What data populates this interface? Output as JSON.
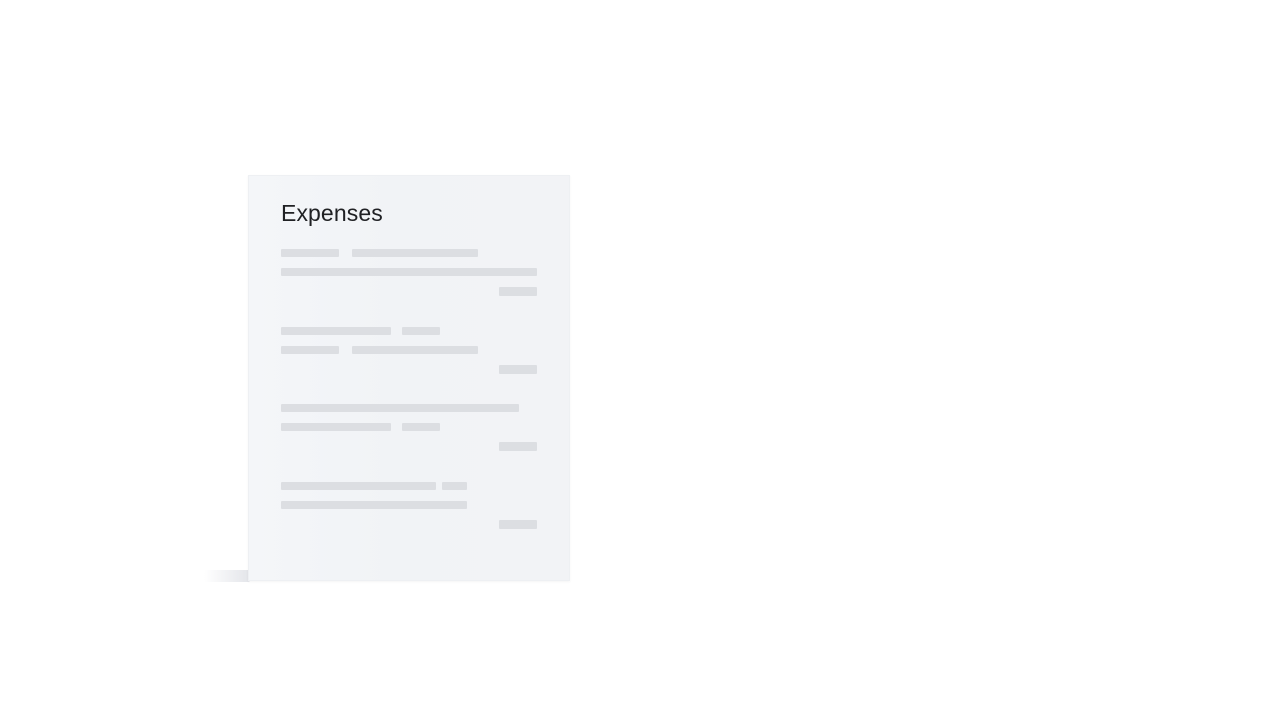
{
  "card": {
    "title": "Expenses"
  },
  "colors": {
    "page_background": "#ffffff",
    "card_background": "#f2f4f7",
    "placeholder_bar": "#dcdee2",
    "title_text": "#202124"
  },
  "expense_items": [
    {
      "state": "loading-placeholder"
    },
    {
      "state": "loading-placeholder"
    },
    {
      "state": "loading-placeholder"
    },
    {
      "state": "loading-placeholder"
    }
  ]
}
